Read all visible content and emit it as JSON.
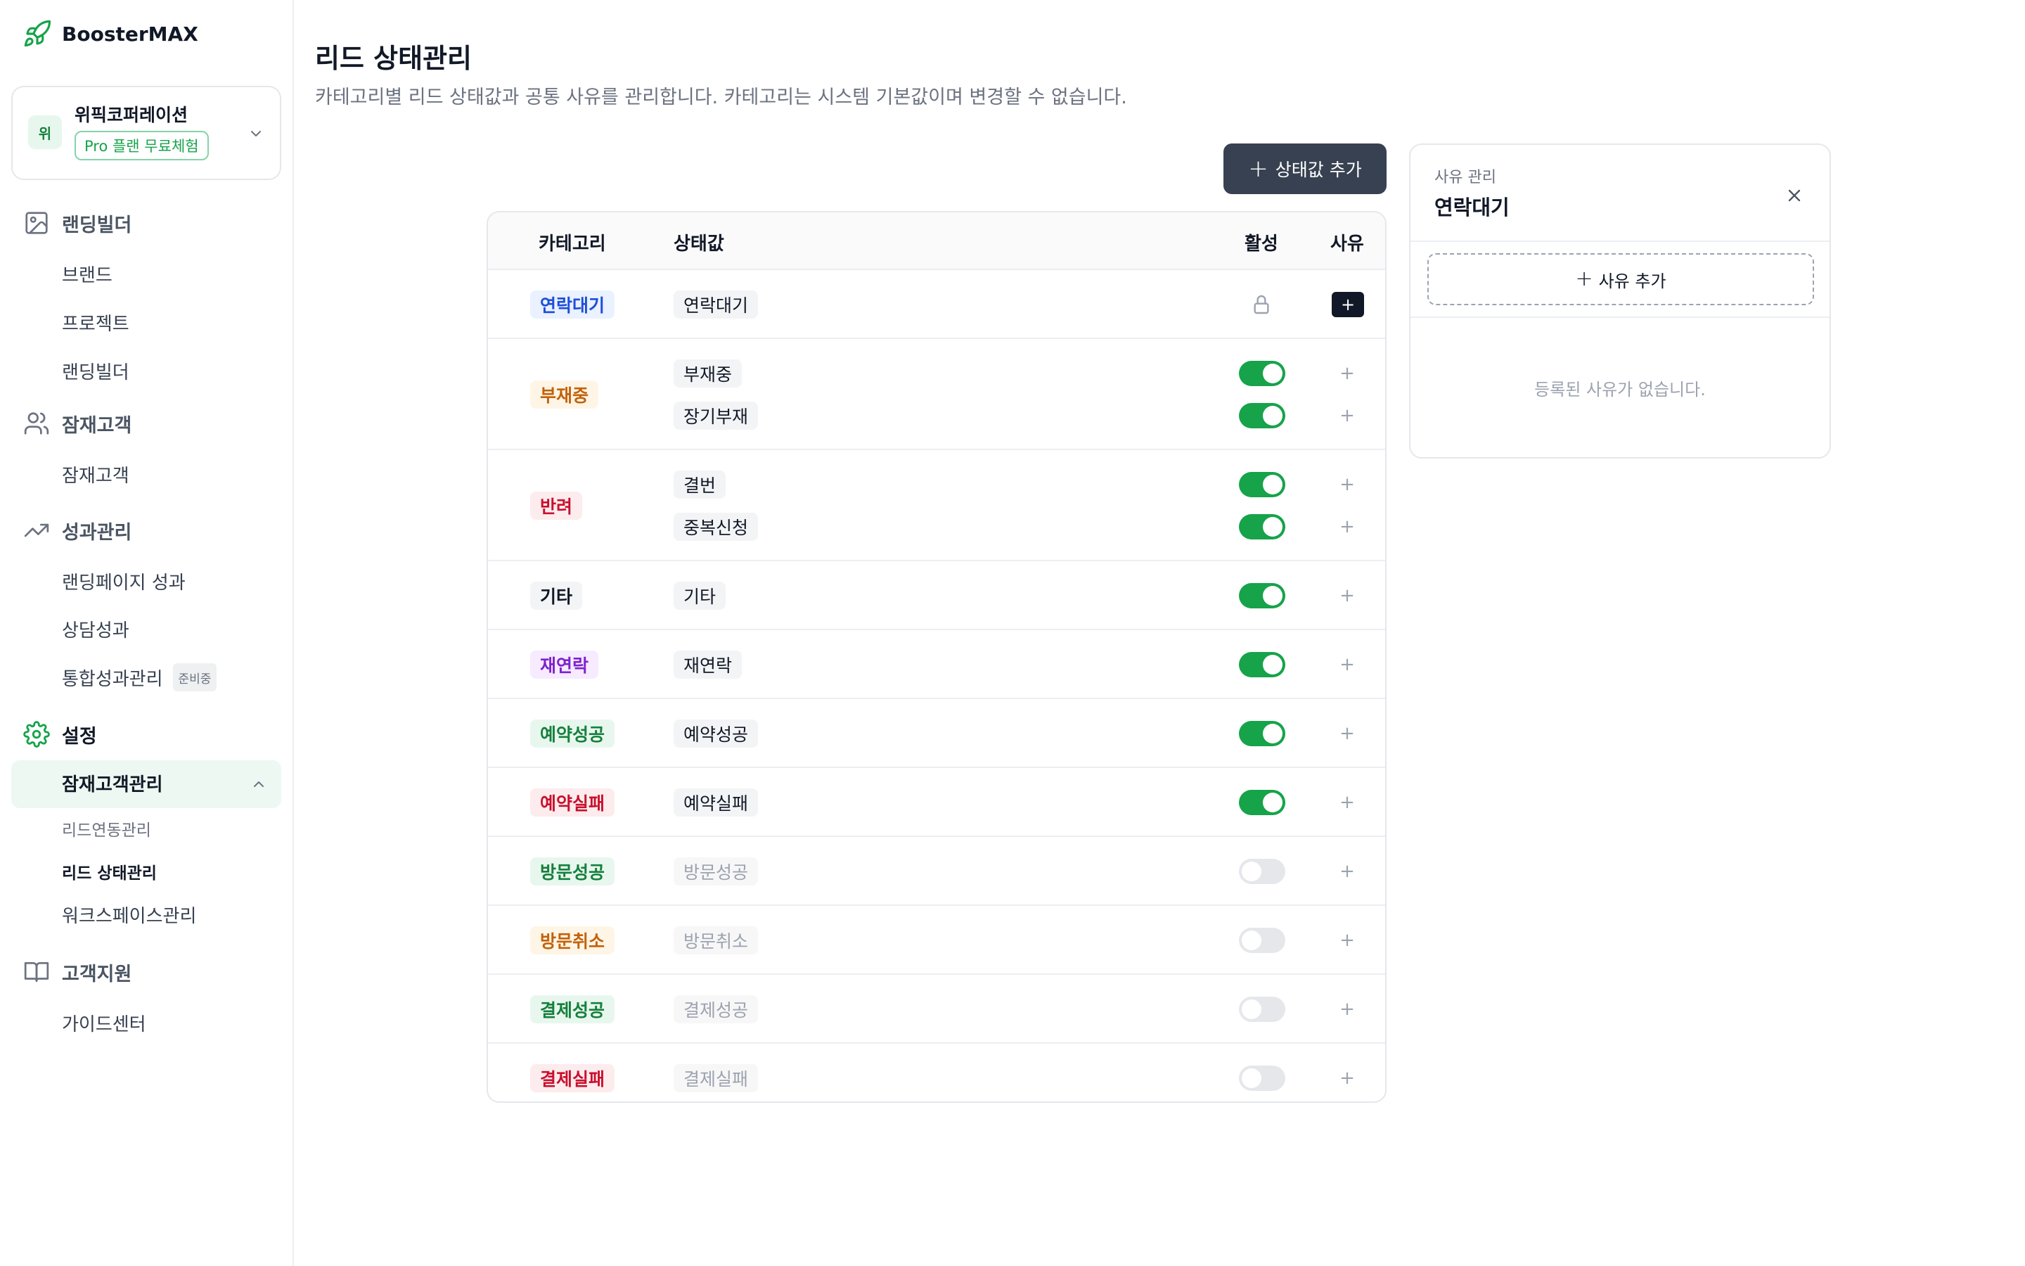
{
  "app": {
    "name": "BoosterMAX"
  },
  "workspace": {
    "avatar": "위",
    "name": "위픽코퍼레이션",
    "plan": "Pro 플랜 무료체험"
  },
  "sidebar": {
    "groups": [
      {
        "label": "랜딩빌더",
        "icon": "image-icon",
        "items": [
          "브랜드",
          "프로젝트",
          "랜딩빌더"
        ]
      },
      {
        "label": "잠재고객",
        "icon": "users-icon",
        "items": [
          "잠재고객"
        ]
      },
      {
        "label": "성과관리",
        "icon": "trending-up-icon",
        "items": [
          "랜딩페이지 성과",
          "상담성과",
          "통합성과관리"
        ],
        "badge": "준비중"
      },
      {
        "label": "설정",
        "icon": "gear-icon",
        "items": []
      },
      {
        "label": "고객지원",
        "icon": "book-icon",
        "items": [
          "가이드센터"
        ]
      }
    ],
    "open_section": {
      "label": "잠재고객관리",
      "items": [
        "리드연동관리",
        "리드 상태관리",
        "워크스페이스관리"
      ]
    }
  },
  "page": {
    "title": "리드 상태관리",
    "description": "카테고리별 리드 상태값과 공통 사유를 관리합니다. 카테고리는 시스템 기본값이며 변경할 수 없습니다.",
    "add_button": "상태값 추가"
  },
  "table": {
    "headers": {
      "category": "카테고리",
      "status": "상태값",
      "active": "활성",
      "reason": "사유"
    },
    "rows": [
      {
        "category": "연락대기",
        "theme": "blue",
        "statuses": [
          {
            "label": "연락대기",
            "locked": true
          }
        ]
      },
      {
        "category": "부재중",
        "theme": "orange",
        "statuses": [
          {
            "label": "부재중",
            "active": true
          },
          {
            "label": "장기부재",
            "active": true
          }
        ]
      },
      {
        "category": "반려",
        "theme": "red",
        "statuses": [
          {
            "label": "결번",
            "active": true
          },
          {
            "label": "중복신청",
            "active": true
          }
        ]
      },
      {
        "category": "기타",
        "theme": "gray",
        "statuses": [
          {
            "label": "기타",
            "active": true
          }
        ]
      },
      {
        "category": "재연락",
        "theme": "purple",
        "statuses": [
          {
            "label": "재연락",
            "active": true
          }
        ]
      },
      {
        "category": "예약성공",
        "theme": "green",
        "statuses": [
          {
            "label": "예약성공",
            "active": true
          }
        ]
      },
      {
        "category": "예약실패",
        "theme": "red",
        "statuses": [
          {
            "label": "예약실패",
            "active": true
          }
        ]
      },
      {
        "category": "방문성공",
        "theme": "green",
        "statuses": [
          {
            "label": "방문성공",
            "active": false
          }
        ]
      },
      {
        "category": "방문취소",
        "theme": "orange",
        "statuses": [
          {
            "label": "방문취소",
            "active": false
          }
        ]
      },
      {
        "category": "결제성공",
        "theme": "green",
        "statuses": [
          {
            "label": "결제성공",
            "active": false
          }
        ]
      },
      {
        "category": "결제실패",
        "theme": "red",
        "statuses": [
          {
            "label": "결제실패",
            "active": false
          }
        ]
      }
    ]
  },
  "themes": {
    "blue": {
      "bg": "#eaf1ff",
      "fg": "#1d4ed8"
    },
    "orange": {
      "bg": "#fff5e6",
      "fg": "#c2620a"
    },
    "red": {
      "bg": "#fdeced",
      "fg": "#c8102e"
    },
    "gray": {
      "bg": "#f3f4f6",
      "fg": "#111827"
    },
    "purple": {
      "bg": "#f6ebff",
      "fg": "#7e22ce"
    },
    "green": {
      "bg": "#e8f7ee",
      "fg": "#15803d"
    }
  },
  "colors": {
    "accent": "#16a34a",
    "primary_button": "#374151"
  },
  "reason_panel": {
    "subtitle": "사유 관리",
    "title": "연락대기",
    "add_button": "사유 추가",
    "empty": "등록된 사유가 없습니다."
  }
}
